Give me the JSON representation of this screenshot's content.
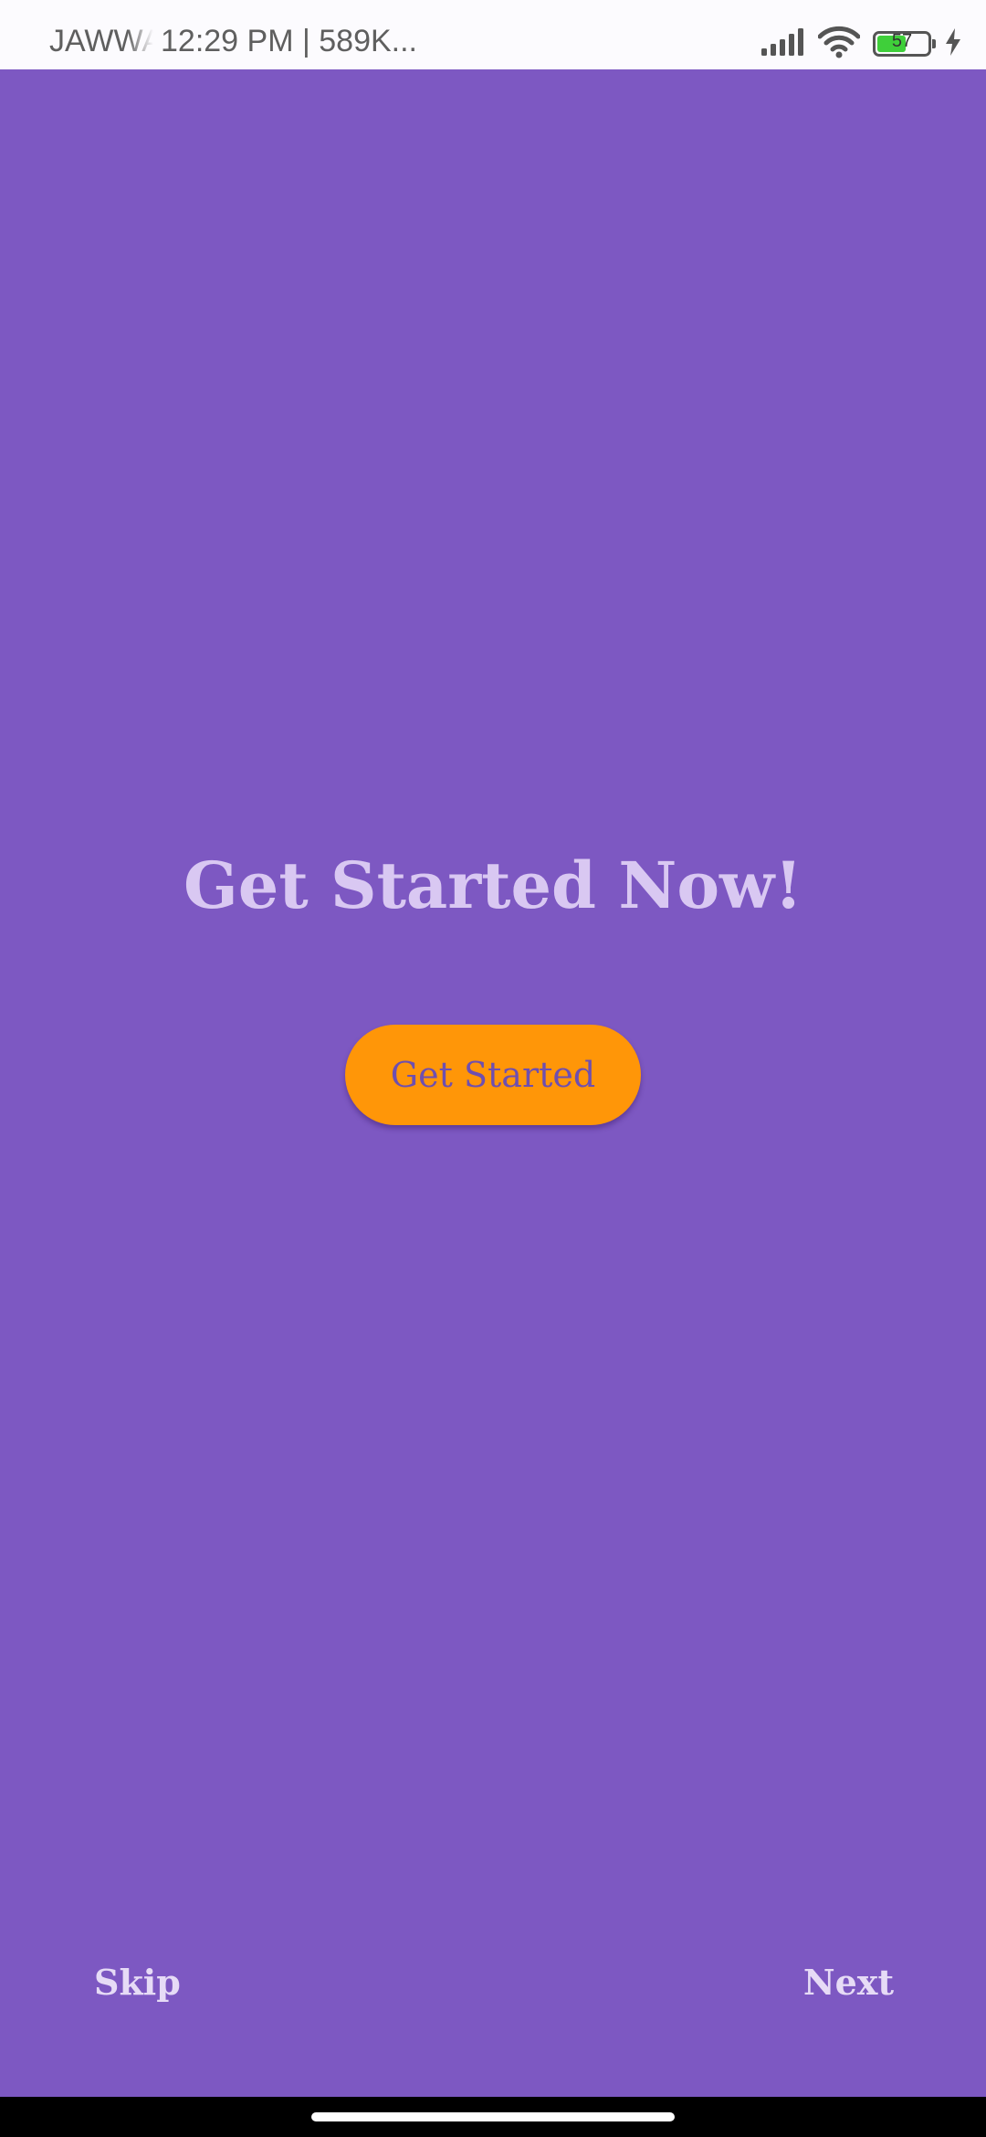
{
  "status_bar": {
    "carrier": "JAWWAL",
    "time_info": "12:29 PM | 589K...",
    "battery_level": "57",
    "battery_fraction": 0.57,
    "icons": [
      "signal-icon",
      "wifi-icon",
      "battery-icon",
      "charging-icon"
    ]
  },
  "main": {
    "headline": "Get Started Now!",
    "cta_label": "Get Started"
  },
  "footer": {
    "skip_label": "Skip",
    "next_label": "Next"
  },
  "colors": {
    "background": "#7d58c2",
    "button": "#ff9608",
    "headline": "#d9c8f2"
  }
}
